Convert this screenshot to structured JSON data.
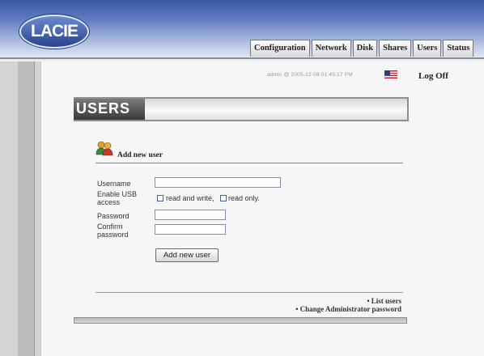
{
  "header": {
    "logo_text": "LACIE",
    "tabs": [
      "Configuration",
      "Network",
      "Disk",
      "Shares",
      "Users",
      "Status"
    ],
    "accent_color": "#3a58a6"
  },
  "status": {
    "text": "admin @ 2005-12-08 01:45:17 PM",
    "flag_icon": "us-flag-icon",
    "logoff_label": "Log Off"
  },
  "page": {
    "title": "USERS",
    "section_title": "Add new user",
    "section_icon": "users-icon"
  },
  "form": {
    "username_label": "Username",
    "username_value": "",
    "usb_label": "Enable USB access",
    "usb_option_rw": "read and write,",
    "usb_option_ro": "read only.",
    "usb_rw_checked": false,
    "usb_ro_checked": false,
    "password_label": "Password",
    "password_value": "",
    "confirm_label": "Confirm password",
    "confirm_value": "",
    "submit_label": "Add new user"
  },
  "links": {
    "list_users": "• List users",
    "change_admin_password": "• Change Administrator password"
  }
}
